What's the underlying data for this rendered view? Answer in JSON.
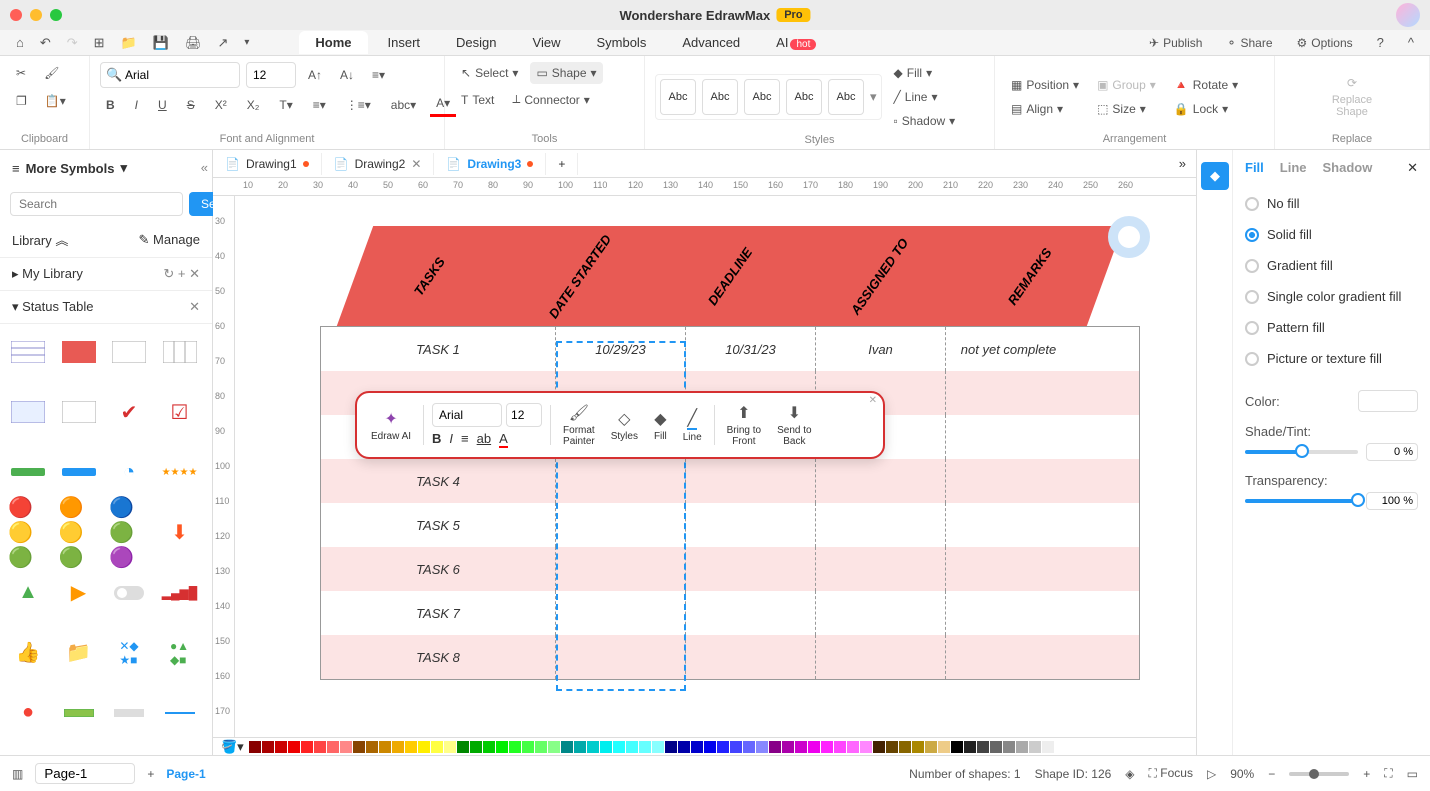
{
  "app": {
    "title": "Wondershare EdrawMax",
    "badge": "Pro"
  },
  "menubar": {
    "tabs": [
      "Home",
      "Insert",
      "Design",
      "View",
      "Symbols",
      "Advanced",
      "AI"
    ],
    "active": "Home",
    "right": {
      "publish": "Publish",
      "share": "Share",
      "options": "Options"
    }
  },
  "ribbon": {
    "font": "Arial",
    "size": "12",
    "select": "Select",
    "shape": "Shape",
    "text": "Text",
    "connector": "Connector",
    "fill": "Fill",
    "line": "Line",
    "shadow": "Shadow",
    "position": "Position",
    "group": "Group",
    "rotate": "Rotate",
    "align": "Align",
    "sizeBtn": "Size",
    "lock": "Lock",
    "replace": "Replace\nShape",
    "replaceLbl": "Replace",
    "groups": {
      "clipboard": "Clipboard",
      "font": "Font and Alignment",
      "tools": "Tools",
      "styles": "Styles",
      "arrangement": "Arrangement"
    },
    "styleBox": "Abc"
  },
  "leftPanel": {
    "title": "More Symbols",
    "searchPlaceholder": "Search",
    "searchBtn": "Search",
    "library": "Library",
    "manage": "Manage",
    "mylib": "My Library",
    "section": "Status Table"
  },
  "docTabs": [
    {
      "name": "Drawing1",
      "modified": true
    },
    {
      "name": "Drawing2",
      "modified": false
    },
    {
      "name": "Drawing3",
      "modified": true,
      "active": true
    }
  ],
  "table": {
    "headers": [
      "TASKS",
      "DATE STARTED",
      "DEADLINE",
      "ASSIGNED TO",
      "REMARKS"
    ],
    "rows": [
      [
        "TASK 1",
        "10/29/23",
        "10/31/23",
        "Ivan",
        "not yet complete"
      ],
      [
        "",
        "",
        "",
        "",
        ""
      ],
      [
        "",
        "",
        "",
        "",
        ""
      ],
      [
        "TASK 4",
        "",
        "",
        "",
        ""
      ],
      [
        "TASK 5",
        "",
        "",
        "",
        ""
      ],
      [
        "TASK 6",
        "",
        "",
        "",
        ""
      ],
      [
        "TASK 7",
        "",
        "",
        "",
        ""
      ],
      [
        "TASK 8",
        "",
        "",
        "",
        ""
      ]
    ]
  },
  "floatToolbar": {
    "ai": "Edraw AI",
    "font": "Arial",
    "size": "12",
    "formatPainter": "Format\nPainter",
    "styles": "Styles",
    "fill": "Fill",
    "line": "Line",
    "bringFront": "Bring to\nFront",
    "sendBack": "Send to\nBack"
  },
  "rightPanel": {
    "tabs": [
      "Fill",
      "Line",
      "Shadow"
    ],
    "active": "Fill",
    "options": [
      "No fill",
      "Solid fill",
      "Gradient fill",
      "Single color gradient fill",
      "Pattern fill",
      "Picture or texture fill"
    ],
    "selected": "Solid fill",
    "colorLbl": "Color:",
    "shadeLbl": "Shade/Tint:",
    "shadeVal": "0 %",
    "transLbl": "Transparency:",
    "transVal": "100 %"
  },
  "statusBar": {
    "page": "Page-1",
    "pageTab": "Page-1",
    "shapes": "Number of shapes: 1",
    "shapeId": "Shape ID: 126",
    "focus": "Focus",
    "zoom": "90%"
  },
  "rulerH": [
    "10",
    "20",
    "30",
    "40",
    "50",
    "60",
    "70",
    "80",
    "90",
    "100",
    "110",
    "120",
    "130",
    "140",
    "150",
    "160",
    "170",
    "180",
    "190",
    "200",
    "210",
    "220",
    "230",
    "240",
    "250",
    "260"
  ],
  "rulerV": [
    "30",
    "40",
    "50",
    "60",
    "70",
    "80",
    "90",
    "100",
    "110",
    "120",
    "130",
    "140",
    "150",
    "160",
    "170"
  ]
}
